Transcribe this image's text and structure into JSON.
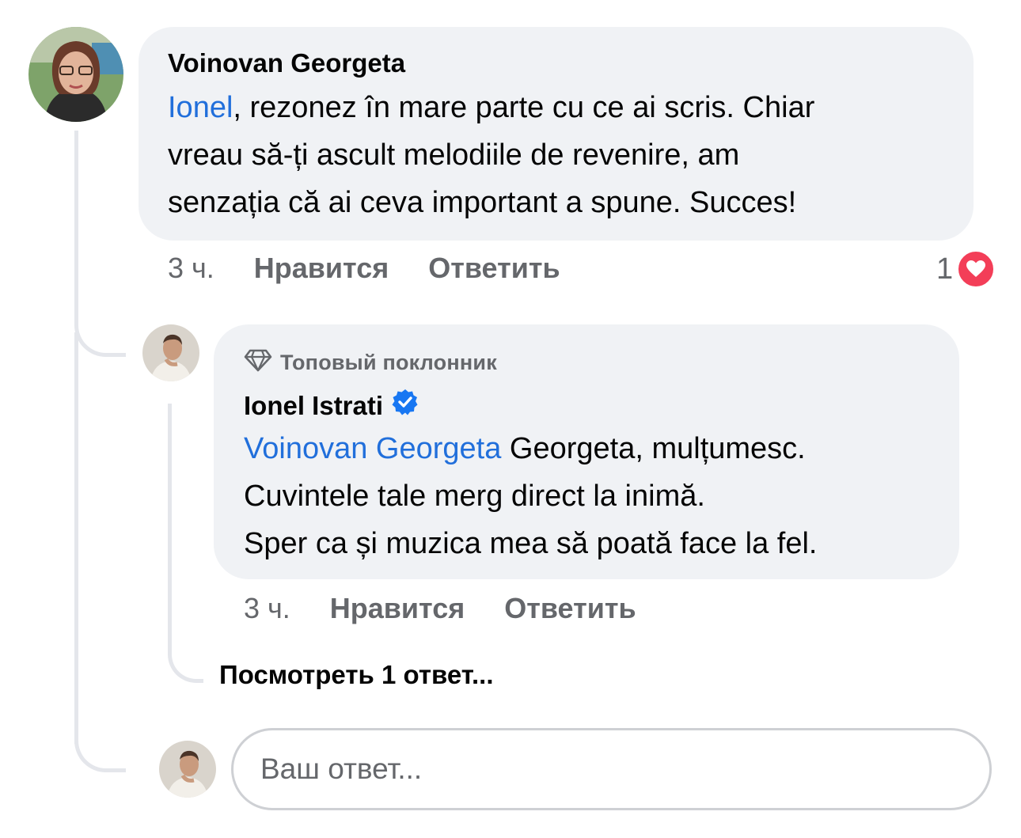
{
  "colors": {
    "bubble_bg": "#f0f2f5",
    "mention": "#216fdb",
    "meta_text": "#65676b",
    "verified": "#1877f2",
    "heart": "#f33e58"
  },
  "comment": {
    "author": "Voinovan Georgeta",
    "mention": "Ionel",
    "line1_rest": ", rezonez în mare parte cu ce ai scris. Chiar",
    "line2": "vreau să-ți ascult melodiile de revenire, am",
    "line3": "senzația că ai ceva important a spune. Succes!",
    "time": "3 ч.",
    "like_label": "Нравится",
    "reply_label": "Ответить",
    "reaction_count": "1",
    "reaction_icon": "heart-icon"
  },
  "reply": {
    "badge_icon": "diamond-icon",
    "badge_label": "Топовый поклонник",
    "author": "Ionel Istrati",
    "verified_icon": "verified-badge-icon",
    "mention": "Voinovan Georgeta",
    "line1_rest": " Georgeta, mulțumesc.",
    "line2": "Cuvintele tale merg direct la inimă.",
    "line3": "Sper ca și muzica mea să poată face la fel.",
    "time": "3 ч.",
    "like_label": "Нравится",
    "reply_label": "Ответить"
  },
  "view_replies_label": "Посмотреть 1 ответ...",
  "reply_input": {
    "placeholder": "Ваш ответ..."
  }
}
